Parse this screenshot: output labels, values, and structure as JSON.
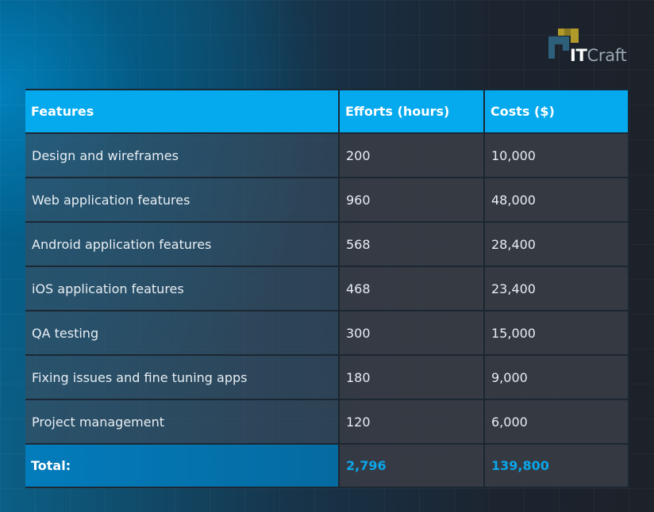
{
  "logo": {
    "it": "IT",
    "craft": "Craft",
    "colors": {
      "mark_dark": "#2e5f7a",
      "mark_gold": "#b09a2a",
      "text_light": "#ffffff",
      "text_gray": "#9aa7b3"
    }
  },
  "table": {
    "headers": [
      "Features",
      "Efforts (hours)",
      "Costs ($)"
    ],
    "rows": [
      {
        "feature": "Design and wireframes",
        "hours": "200",
        "cost": "10,000"
      },
      {
        "feature": "Web application features",
        "hours": "960",
        "cost": "48,000"
      },
      {
        "feature": "Android application features",
        "hours": "568",
        "cost": "28,400"
      },
      {
        "feature": "iOS application features",
        "hours": "468",
        "cost": "23,400"
      },
      {
        "feature": "QA testing",
        "hours": "300",
        "cost": "15,000"
      },
      {
        "feature": "Fixing issues and fine tuning apps",
        "hours": "180",
        "cost": "9,000"
      },
      {
        "feature": "Project management",
        "hours": "120",
        "cost": "6,000"
      }
    ],
    "total": {
      "label": "Total:",
      "hours": "2,796",
      "cost": "139,800"
    }
  },
  "colors": {
    "header_bg": "#05a9ee",
    "total_value": "#0aa6ea",
    "total_label_bg": "#037cbc"
  }
}
